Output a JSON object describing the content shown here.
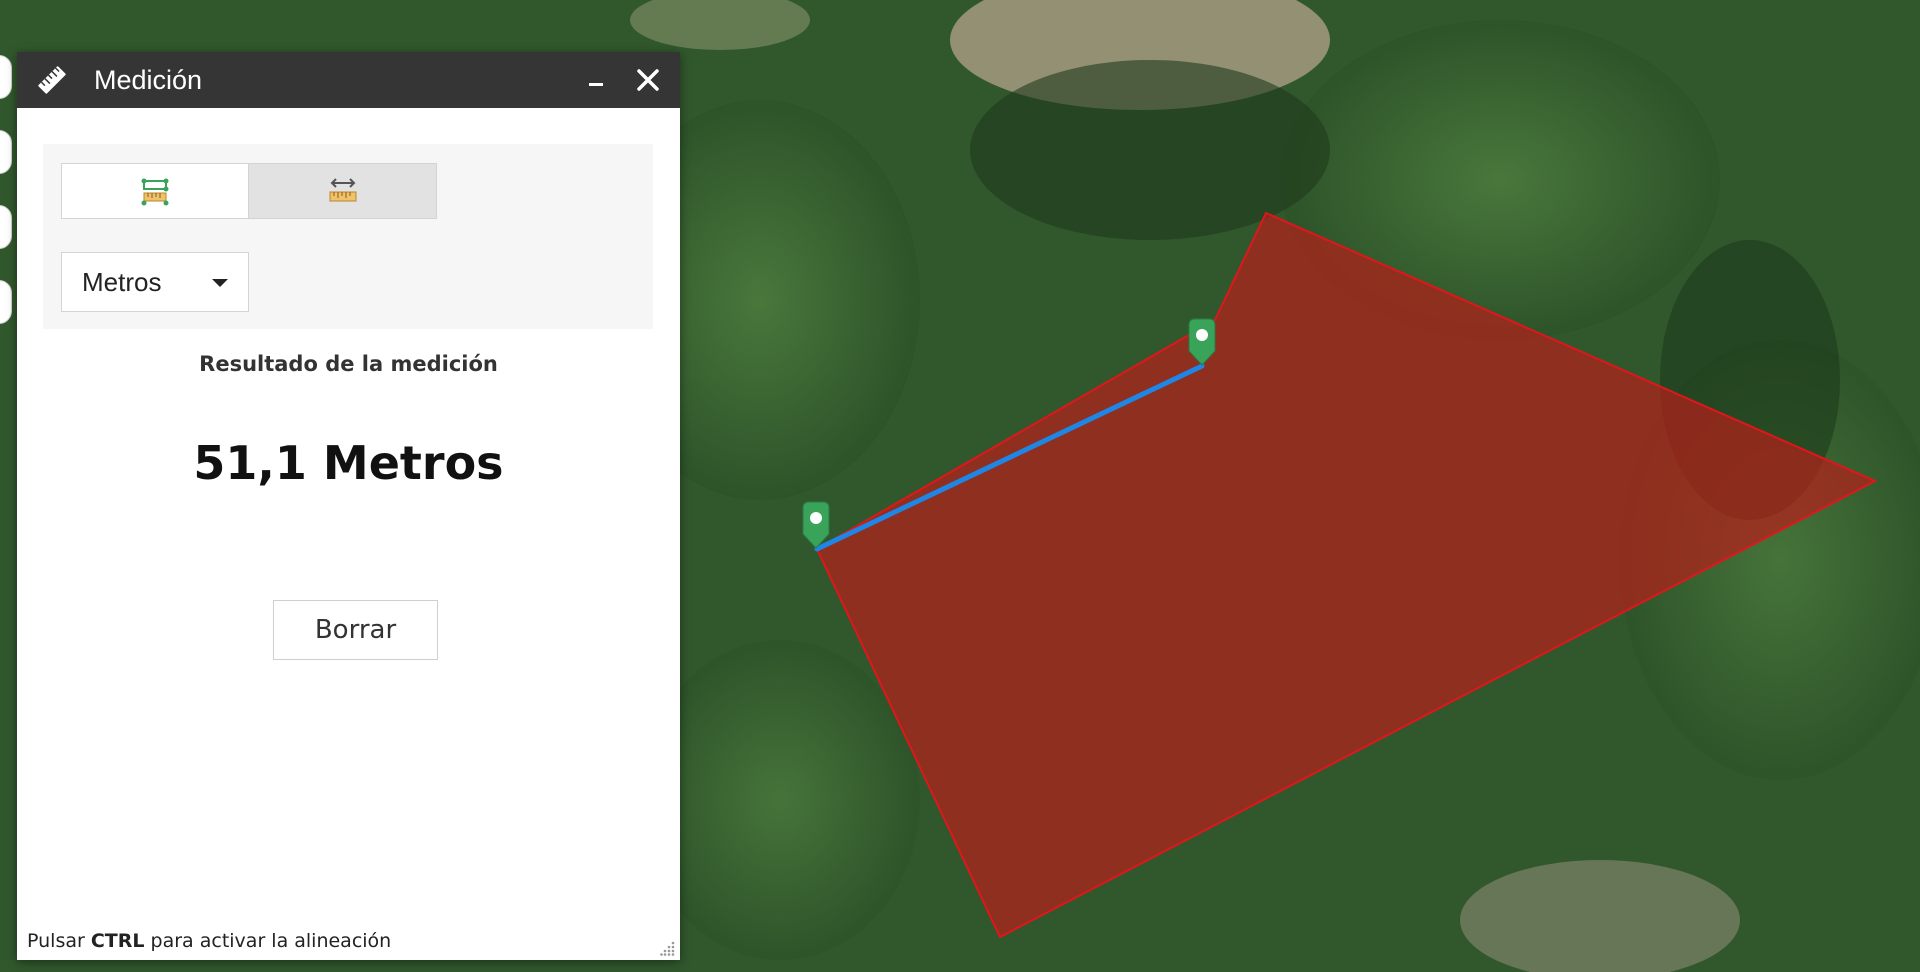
{
  "window": {
    "title": "Medición",
    "minimize_label": "–",
    "close_label": "×"
  },
  "toolbar": {
    "area_tool_icon": "area-ruler-icon",
    "distance_tool_icon": "distance-ruler-icon",
    "active_tool": "distance"
  },
  "unit_select": {
    "selected": "Metros"
  },
  "result": {
    "label": "Resultado de la medición",
    "value": "51,1 Metros"
  },
  "clear_button": {
    "label": "Borrar"
  },
  "hint": {
    "prefix": "Pulsar ",
    "key": "CTRL",
    "suffix": " para activar la alineación"
  },
  "map": {
    "basemap": "satellite imagery",
    "polygon_fill": "#b3201a",
    "polygon_stroke": "#e0161b",
    "line_color": "#1f86e6",
    "marker_color": "#3aa35a"
  }
}
